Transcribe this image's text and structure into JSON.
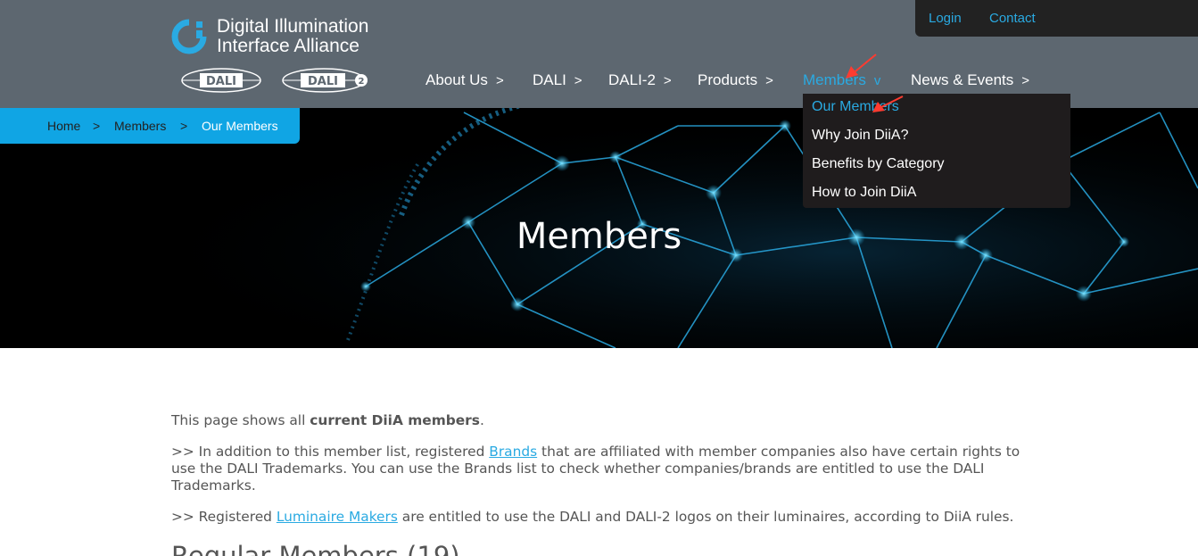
{
  "header": {
    "logo_text_line1": "Digital Illumination",
    "logo_text_line2": "Interface Alliance",
    "badges": [
      "DALI",
      "DALI"
    ],
    "badge2_superscript": "2"
  },
  "topbar": {
    "login": "Login",
    "contact": "Contact"
  },
  "nav": {
    "items": [
      {
        "label": "About Us",
        "chevron": ">"
      },
      {
        "label": "DALI",
        "chevron": ">"
      },
      {
        "label": "DALI-2",
        "chevron": ">"
      },
      {
        "label": "Products",
        "chevron": ">"
      },
      {
        "label": "Members",
        "chevron": "v"
      },
      {
        "label": "News & Events",
        "chevron": ">"
      }
    ]
  },
  "dropdown": {
    "items": [
      "Our Members",
      "Why Join DiiA?",
      "Benefits by Category",
      "How to Join DiiA"
    ]
  },
  "breadcrumb": {
    "home": "Home",
    "sep": ">",
    "members": "Members",
    "current": "Our Members"
  },
  "hero": {
    "title": "Members"
  },
  "content": {
    "p1_prefix": "This page shows all ",
    "p1_bold": "current DiiA members",
    "p1_suffix": ".",
    "p2_prefix": ">> In addition to this member list, registered ",
    "p2_link": "Brands",
    "p2_suffix": " that are affiliated with member companies also have certain rights to use the DALI Trademarks. You can use the Brands list to check whether companies/brands are entitled to use the DALI Trademarks.",
    "p3_prefix": ">> Registered ",
    "p3_link": "Luminaire Makers",
    "p3_suffix": " are entitled to use the DALI and DALI-2 logos on their luminaires, according to DiiA rules.",
    "heading": "Regular Members (19)"
  },
  "colors": {
    "header_bg": "#5d6770",
    "accent": "#2aaae2",
    "breadcrumb_bg": "#10a5e4",
    "dropdown_bg": "#1f1c1d",
    "arrow": "#ff3b30"
  }
}
